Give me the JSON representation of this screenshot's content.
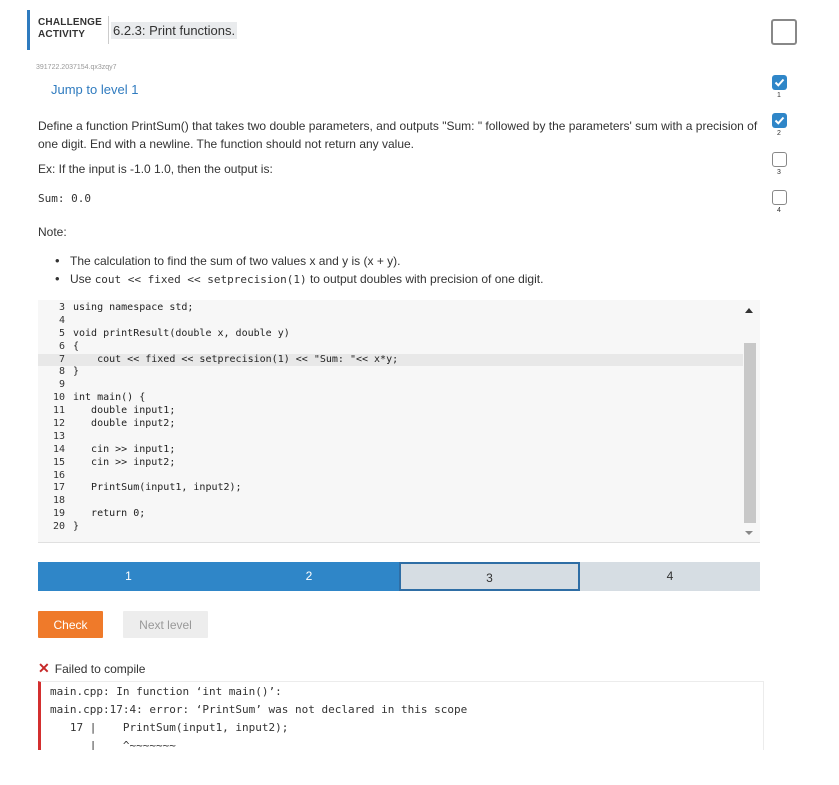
{
  "header": {
    "challenge_label_1": "CHALLENGE",
    "challenge_label_2": "ACTIVITY",
    "title": "6.2.3: Print functions."
  },
  "challenge_id": "391722.2037154.qx3zqy7",
  "jump_link": "Jump to level 1",
  "instructions": "Define a function PrintSum() that takes two double parameters, and outputs \"Sum: \" followed by the parameters' sum with a precision of one digit. End with a newline. The function should not return any value.",
  "example": "Ex: If the input is -1.0 1.0, then the output is:",
  "sample_output": "Sum: 0.0",
  "note_label": "Note:",
  "bullets": [
    {
      "text": "The calculation to find the sum of two values x and y is (x + y)."
    },
    {
      "pre": "Use ",
      "code": "cout << fixed << setprecision(1)",
      "post": " to output doubles with precision of one digit."
    }
  ],
  "code": [
    {
      "ln": "3",
      "text": "using namespace std;"
    },
    {
      "ln": "4",
      "text": ""
    },
    {
      "ln": "5",
      "text": "void printResult(double x, double y)"
    },
    {
      "ln": "6",
      "text": "{"
    },
    {
      "ln": "7",
      "text": "    cout << fixed << setprecision(1) << \"Sum: \"<< x*y;"
    },
    {
      "ln": "8",
      "text": "}"
    },
    {
      "ln": "9",
      "text": ""
    },
    {
      "ln": "10",
      "text": "int main() {"
    },
    {
      "ln": "11",
      "text": "   double input1;"
    },
    {
      "ln": "12",
      "text": "   double input2;"
    },
    {
      "ln": "13",
      "text": ""
    },
    {
      "ln": "14",
      "text": "   cin >> input1;"
    },
    {
      "ln": "15",
      "text": "   cin >> input2;"
    },
    {
      "ln": "16",
      "text": ""
    },
    {
      "ln": "17",
      "text": "   PrintSum(input1, input2);"
    },
    {
      "ln": "18",
      "text": ""
    },
    {
      "ln": "19",
      "text": "   return 0;"
    },
    {
      "ln": "20",
      "text": "}"
    }
  ],
  "active_line": "7",
  "levels": [
    {
      "label": "1",
      "state": "done"
    },
    {
      "label": "2",
      "state": "done"
    },
    {
      "label": "3",
      "state": "current"
    },
    {
      "label": "4",
      "state": "todo"
    }
  ],
  "buttons": {
    "check": "Check",
    "next_level": "Next level"
  },
  "result": {
    "status": "Failed to compile",
    "lines": [
      "main.cpp: In function ‘int main()’:",
      "main.cpp:17:4: error: ‘PrintSum’ was not declared in this scope",
      "   17 |    PrintSum(input1, input2);",
      "      |    ^~~~~~~~"
    ]
  },
  "sidebar": [
    {
      "num": "1",
      "state": "done"
    },
    {
      "num": "2",
      "state": "done"
    },
    {
      "num": "3",
      "state": "todo"
    },
    {
      "num": "4",
      "state": "todo"
    }
  ],
  "colors": {
    "accent_blue": "#2f86c8",
    "check_orange": "#ef7a2a",
    "error_red": "#d32f2f"
  }
}
